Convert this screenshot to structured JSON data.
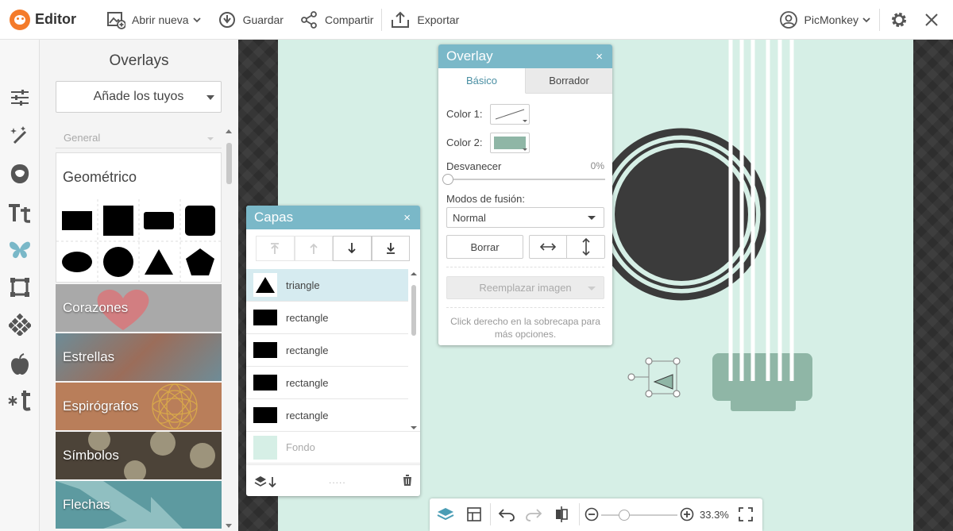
{
  "app": {
    "title": "Editor",
    "brand_color": "#f47b2a"
  },
  "toolbar": {
    "open_label": "Abrir nueva",
    "save_label": "Guardar",
    "share_label": "Compartir",
    "export_label": "Exportar",
    "account_label": "PicMonkey"
  },
  "rail": {
    "icons": [
      "adjustments-icon",
      "magic-wand-icon",
      "face-icon",
      "text-icon",
      "butterfly-icon",
      "frame-icon",
      "texture-icon",
      "apple-icon",
      "themes-icon"
    ],
    "active": "butterfly-icon",
    "active_color": "#7ab8c8"
  },
  "panel": {
    "title": "Overlays",
    "add_button": "Añade los tuyos",
    "filter": "General",
    "geo_title": "Geométrico",
    "categories": [
      {
        "label": "Corazones",
        "bg": "#a9a9a9",
        "accent": "#d9777a"
      },
      {
        "label": "Estrellas",
        "bg": "#6e8c97",
        "accent": "#9b6d5a"
      },
      {
        "label": "Espirógrafos",
        "bg": "#b97e5a",
        "accent": "#d9a94a"
      },
      {
        "label": "Símbolos",
        "bg": "#4c4338",
        "accent": "#c0b79a"
      },
      {
        "label": "Flechas",
        "bg": "#5d9aa0",
        "accent": "#a7cfcf"
      }
    ]
  },
  "layers": {
    "title": "Capas",
    "close": "×",
    "items": [
      {
        "label": "triangle",
        "shape": "triangle",
        "selected": true
      },
      {
        "label": "rectangle",
        "shape": "rectangle",
        "selected": false
      },
      {
        "label": "rectangle",
        "shape": "rectangle",
        "selected": false
      },
      {
        "label": "rectangle",
        "shape": "rectangle",
        "selected": false
      },
      {
        "label": "rectangle",
        "shape": "rectangle",
        "selected": false
      }
    ],
    "background_label": "Fondo",
    "background_color": "#d6efe6",
    "footer_dots": "....."
  },
  "overlay": {
    "title": "Overlay",
    "close": "×",
    "tab_basic": "Básico",
    "tab_eraser": "Borrador",
    "color1_label": "Color 1:",
    "color2_label": "Color 2:",
    "color2_value": "#8fb6a6",
    "fade_label": "Desvanecer",
    "fade_value": "0%",
    "fade_fraction": 0,
    "blend_label": "Modos de fusión:",
    "blend_value": "Normal",
    "clear_label": "Borrar",
    "replace_label": "Reemplazar imagen",
    "hint": "Click derecho en la sobrecapa para más opciones."
  },
  "bottom": {
    "zoom": "33.3%",
    "zoom_fraction": 0.3
  },
  "colors": {
    "canvas": "#d6efe6",
    "dark": "#3b3b3b",
    "bridge": "#8fb6a6",
    "panel_header": "#7ab8c8"
  }
}
